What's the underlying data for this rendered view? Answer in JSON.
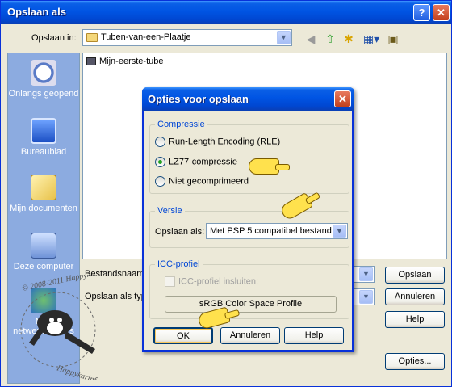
{
  "window": {
    "title": "Opslaan als"
  },
  "lookin": {
    "label": "Opslaan in:",
    "value": "Tuben-van-een-Plaatje"
  },
  "toolbar_icons": [
    "back-icon",
    "up-folder-icon",
    "new-folder-icon",
    "view-menu-icon",
    "tools-icon"
  ],
  "places": [
    {
      "label": "Onlangs geopend",
      "icon": "recent-documents-icon"
    },
    {
      "label": "Bureaublad",
      "icon": "desktop-icon"
    },
    {
      "label": "Mijn documenten",
      "icon": "my-documents-icon"
    },
    {
      "label": "Deze computer",
      "icon": "my-computer-icon"
    },
    {
      "label": "Mijn netwerklocaties",
      "icon": "network-places-icon"
    }
  ],
  "files": [
    {
      "name": "Mijn-eerste-tube"
    }
  ],
  "filename": {
    "label": "Bestandsnaam:"
  },
  "filetype": {
    "label": "Opslaan als type:"
  },
  "buttons": {
    "save": "Opslaan",
    "cancel": "Annuleren",
    "help": "Help",
    "options": "Opties..."
  },
  "dialog": {
    "title": "Opties voor opslaan",
    "compression": {
      "title": "Compressie",
      "options": [
        {
          "label": "Run-Length Encoding (RLE)",
          "selected": false
        },
        {
          "label": "LZ77-compressie",
          "selected": true
        },
        {
          "label": "Niet gecomprimeerd",
          "selected": false
        }
      ]
    },
    "version": {
      "title": "Versie",
      "label": "Opslaan als:",
      "value": "Met PSP 5 compatibel bestand"
    },
    "icc": {
      "title": "ICC-profiel",
      "checkbox": "ICC-profiel insluiten:",
      "profile": "sRGB Color Space Profile"
    },
    "buttons": {
      "ok": "OK",
      "cancel": "Annuleren",
      "help": "Help"
    }
  },
  "watermark": {
    "text1": "© 2008-2011 Happykarin",
    "text2": "Happykarinfan © 2008-2011"
  },
  "colors": {
    "titlebar": "#0054e3",
    "places_bg": "#8cabe0",
    "group_title": "#0046d5",
    "hand": "#ffe14d"
  }
}
